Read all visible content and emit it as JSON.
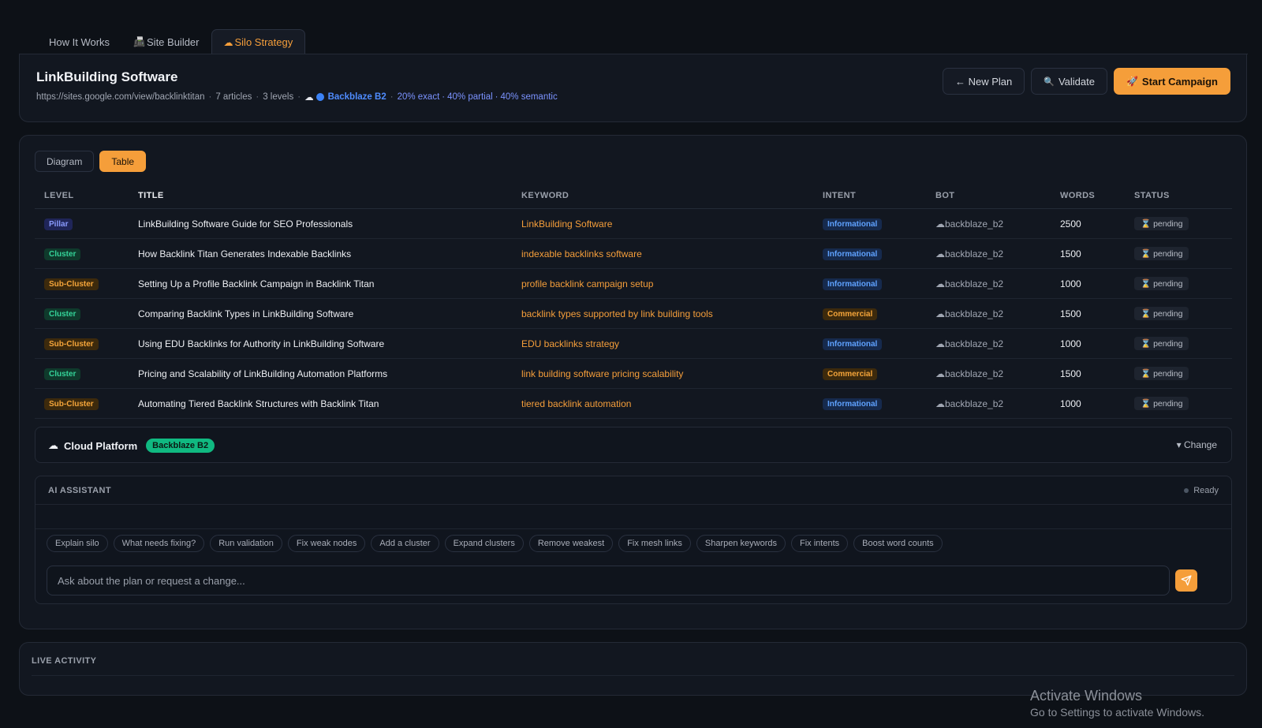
{
  "tabs": [
    {
      "label": "How It Works",
      "icon": ""
    },
    {
      "label": "Site Builder",
      "icon": "📠"
    },
    {
      "label": "Silo Strategy",
      "icon": "☁"
    }
  ],
  "plan": {
    "title": "LinkBuilding Software",
    "url": "https://sites.google.com/view/backlinktitan",
    "articles": "7 articles",
    "levels": "3 levels",
    "cloud_icon": "☁",
    "platform": "Backblaze B2",
    "exact": "20% exact",
    "partial": "40% partial",
    "semantic": "40% semantic"
  },
  "header_buttons": {
    "new_plan": "← New Plan",
    "validate_icon": "🔍",
    "validate": "Validate",
    "start_icon": "🚀",
    "start": "Start Campaign"
  },
  "view_toggle": {
    "diagram": "Diagram",
    "table": "Table"
  },
  "table": {
    "headers": [
      "LEVEL",
      "TITLE",
      "KEYWORD",
      "INTENT",
      "BOT",
      "WORDS",
      "STATUS"
    ],
    "rows": [
      {
        "level": "Pillar",
        "title": "LinkBuilding Software Guide for SEO Professionals",
        "keyword": "LinkBuilding Software",
        "intent": "Informational",
        "bot": "☁backblaze_b2",
        "words": "2500",
        "status_icon": "⌛",
        "status": "pending"
      },
      {
        "level": "Cluster",
        "title": "How Backlink Titan Generates Indexable Backlinks",
        "keyword": "indexable backlinks software",
        "intent": "Informational",
        "bot": "☁backblaze_b2",
        "words": "1500",
        "status_icon": "⌛",
        "status": "pending"
      },
      {
        "level": "Sub-Cluster",
        "title": "Setting Up a Profile Backlink Campaign in Backlink Titan",
        "keyword": "profile backlink campaign setup",
        "intent": "Informational",
        "bot": "☁backblaze_b2",
        "words": "1000",
        "status_icon": "⌛",
        "status": "pending"
      },
      {
        "level": "Cluster",
        "title": "Comparing Backlink Types in LinkBuilding Software",
        "keyword": "backlink types supported by link building tools",
        "intent": "Commercial",
        "bot": "☁backblaze_b2",
        "words": "1500",
        "status_icon": "⌛",
        "status": "pending"
      },
      {
        "level": "Sub-Cluster",
        "title": "Using EDU Backlinks for Authority in LinkBuilding Software",
        "keyword": "EDU backlinks strategy",
        "intent": "Informational",
        "bot": "☁backblaze_b2",
        "words": "1000",
        "status_icon": "⌛",
        "status": "pending"
      },
      {
        "level": "Cluster",
        "title": "Pricing and Scalability of LinkBuilding Automation Platforms",
        "keyword": "link building software pricing scalability",
        "intent": "Commercial",
        "bot": "☁backblaze_b2",
        "words": "1500",
        "status_icon": "⌛",
        "status": "pending"
      },
      {
        "level": "Sub-Cluster",
        "title": "Automating Tiered Backlink Structures with Backlink Titan",
        "keyword": "tiered backlink automation",
        "intent": "Informational",
        "bot": "☁backblaze_b2",
        "words": "1000",
        "status_icon": "⌛",
        "status": "pending"
      }
    ]
  },
  "cloud": {
    "icon": "☁",
    "label": "Cloud Platform",
    "value": "Backblaze B2",
    "change": "▾ Change"
  },
  "ai": {
    "title": "AI ASSISTANT",
    "status": "Ready",
    "chips": [
      "Explain silo",
      "What needs fixing?",
      "Run validation",
      "Fix weak nodes",
      "Add a cluster",
      "Expand clusters",
      "Remove weakest",
      "Fix mesh links",
      "Sharpen keywords",
      "Fix intents",
      "Boost word counts"
    ],
    "placeholder": "Ask about the plan or request a change..."
  },
  "live": {
    "title": "LIVE ACTIVITY"
  },
  "watermark": {
    "line1": "Activate Windows",
    "line2": "Go to Settings to activate Windows."
  },
  "colors": {
    "accent": "#f59e3a",
    "background": "#0d1117",
    "panel": "#121720",
    "success": "#10b981",
    "info": "#5fa2ff"
  }
}
